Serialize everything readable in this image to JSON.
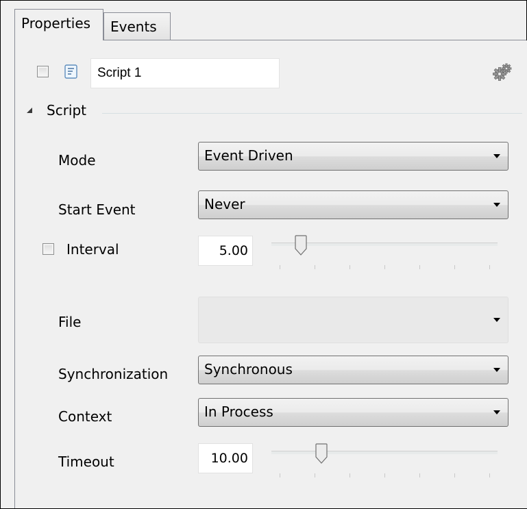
{
  "tabs": [
    {
      "label": "Properties",
      "active": true
    },
    {
      "label": "Events",
      "active": false
    }
  ],
  "header": {
    "enabled_checked": false,
    "script_icon": "script-document-icon",
    "name_value": "Script 1",
    "settings_icon": "gears-icon"
  },
  "section": {
    "title": "Script",
    "expanded": true,
    "collapse_icon": "triangle-collapse-icon"
  },
  "fields": {
    "mode": {
      "label": "Mode",
      "value": "Event Driven"
    },
    "start_event": {
      "label": "Start Event",
      "value": "Never"
    },
    "interval": {
      "label": "Interval",
      "checked": false,
      "value": "5.00",
      "slider_fraction": 0.1
    },
    "file": {
      "label": "File",
      "value": ""
    },
    "synchronization": {
      "label": "Synchronization",
      "value": "Synchronous"
    },
    "context": {
      "label": "Context",
      "value": "In Process"
    },
    "timeout": {
      "label": "Timeout",
      "value": "10.00",
      "slider_fraction": 0.2
    }
  },
  "colors": {
    "panel_background": "#f0f0f0",
    "border": "#898c95",
    "combo_border": "#707070"
  }
}
